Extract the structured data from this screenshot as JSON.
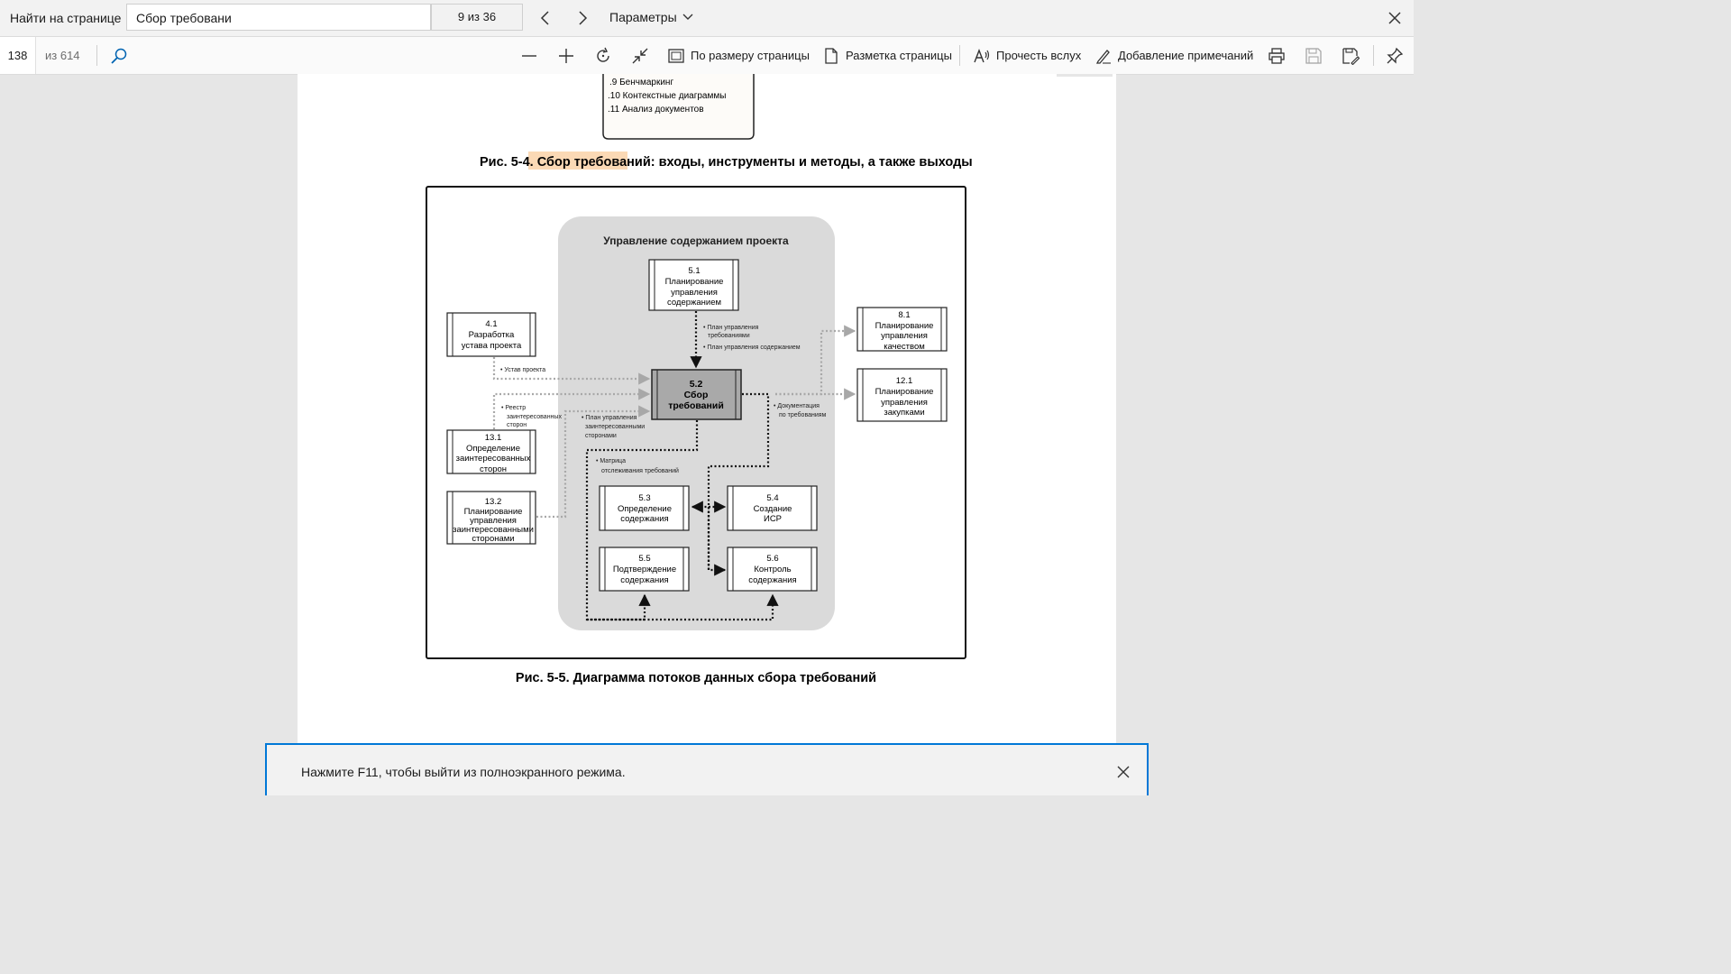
{
  "find": {
    "label": "Найти на странице",
    "query": "Сбор требовани",
    "count": "9 из 36",
    "params_label": "Параметры"
  },
  "toolbar": {
    "page_number": "138",
    "page_total": "из 614",
    "fit_page": "По размеру страницы",
    "page_layout": "Разметка страницы",
    "read_aloud": "Прочесть вслух",
    "add_notes": "Добавление примечаний"
  },
  "document": {
    "top_box": [
      ".9  Бенчмаркинг",
      ".10  Контекстные диаграммы",
      ".11  Анализ документов"
    ],
    "caption_1_prefix": "Рис. 5-4. ",
    "caption_1_highlight": "Сбор требований",
    "caption_1_suffix": ": входы, инструменты и методы, а также выходы",
    "diagram": {
      "group_title": "Управление содержанием проекта",
      "box_51": [
        "5.1",
        "Планирование",
        "управления",
        "содержанием"
      ],
      "box_52": [
        "5.2",
        "Сбор",
        "требований"
      ],
      "box_41": [
        "4.1",
        "Разработка",
        "устава проекта"
      ],
      "box_131": [
        "13.1",
        "Определение",
        "заинтересованных",
        "сторон"
      ],
      "box_132": [
        "13.2",
        "Планирование",
        "управления",
        "заинтересованными",
        "сторонами"
      ],
      "box_81": [
        "8.1",
        "Планирование",
        "управления",
        "качеством"
      ],
      "box_121": [
        "12.1",
        "Планирование",
        "управления",
        "закупками"
      ],
      "box_53": [
        "5.3",
        "Определение",
        "содержания"
      ],
      "box_54": [
        "5.4",
        "Создание",
        "ИСР"
      ],
      "box_55": [
        "5.5",
        "Подтверждение",
        "содержания"
      ],
      "box_56": [
        "5.6",
        "Контроль",
        "содержания"
      ],
      "label_plans": [
        "• План управления",
        "требованиями",
        "• План управления содержанием"
      ],
      "label_charter": "• Устав проекта",
      "label_register": [
        "• Реестр",
        "заинтересованных",
        "сторон"
      ],
      "label_stakeholder_plan": [
        "• План управления",
        "заинтересованными",
        "сторонами"
      ],
      "label_docs": [
        "• Документация",
        "по требованиям"
      ],
      "label_matrix": [
        "• Матрица",
        "отслеживания требований"
      ]
    },
    "caption_2": "Рис. 5-5. Диаграмма потоков данных сбора требований"
  },
  "banner": {
    "text": "Нажмите F11, чтобы выйти из полноэкранного режима."
  },
  "colors": {
    "accent": "#0078d7",
    "highlight": "#fbd9b5"
  }
}
